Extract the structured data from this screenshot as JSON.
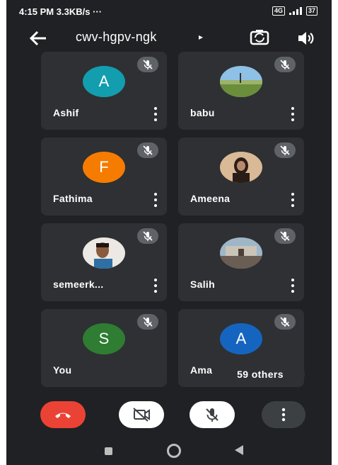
{
  "status_bar": {
    "time": "4:15 PM",
    "speed": "3.3KB/s",
    "extra": "···",
    "signal": "4G",
    "battery": "37"
  },
  "header": {
    "meeting_code": "cwv-hgpv-ngk",
    "caret": "▸"
  },
  "participants": [
    {
      "name": "Ashif",
      "initial": "A",
      "avatar_type": "initial",
      "avatar_color": "#129eaf"
    },
    {
      "name": "babu",
      "initial": "",
      "avatar_type": "photo-landscape",
      "avatar_color": "#7fb0d8"
    },
    {
      "name": "Fathima",
      "initial": "F",
      "avatar_type": "initial",
      "avatar_color": "#f57c00"
    },
    {
      "name": "Ameena",
      "initial": "",
      "avatar_type": "photo-person",
      "avatar_color": "#c9a98b"
    },
    {
      "name": "semeerk...",
      "initial": "",
      "avatar_type": "photo-person",
      "avatar_color": "#e6e3de"
    },
    {
      "name": "Salih",
      "initial": "",
      "avatar_type": "photo-scene",
      "avatar_color": "#8aa6b8"
    },
    {
      "name": "You",
      "initial": "S",
      "avatar_type": "initial",
      "avatar_color": "#2e7d32"
    },
    {
      "name": "Ama",
      "initial": "A",
      "avatar_type": "initial",
      "avatar_color": "#1565c0"
    }
  ],
  "others_chip": "59 others",
  "controls": {
    "end_call": "end-call",
    "camera": "camera-off",
    "mic": "mic-off",
    "more": "more-options"
  },
  "colors": {
    "background": "#202124",
    "tile": "#2e3033",
    "end_call": "#ea4335",
    "mute_badge": "#5f6368"
  }
}
